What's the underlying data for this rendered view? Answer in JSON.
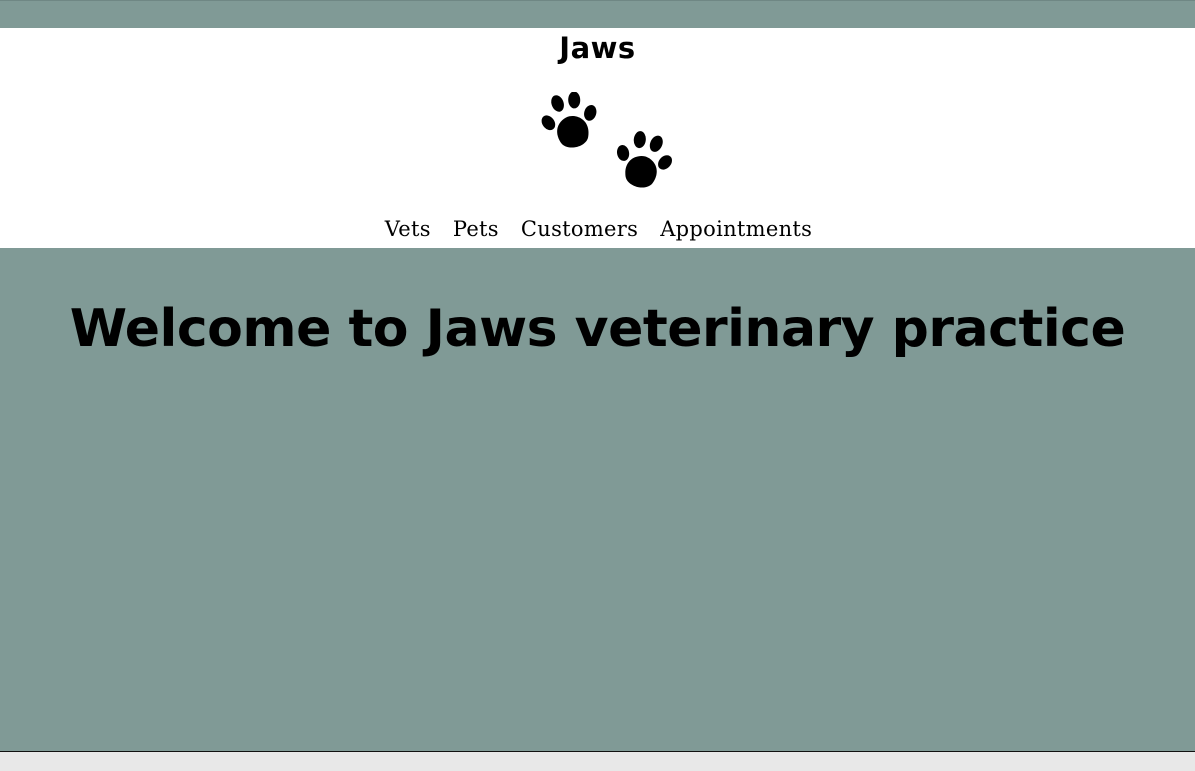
{
  "header": {
    "brand_title": "Jaws",
    "logo_icon": "paw-prints-icon"
  },
  "nav": {
    "items": [
      {
        "label": "Vets"
      },
      {
        "label": "Pets"
      },
      {
        "label": "Customers"
      },
      {
        "label": "Appointments"
      }
    ]
  },
  "main": {
    "heading": "Welcome to Jaws veterinary practice"
  },
  "colors": {
    "background": "#809a96",
    "header_background": "#ffffff",
    "text": "#000000"
  }
}
